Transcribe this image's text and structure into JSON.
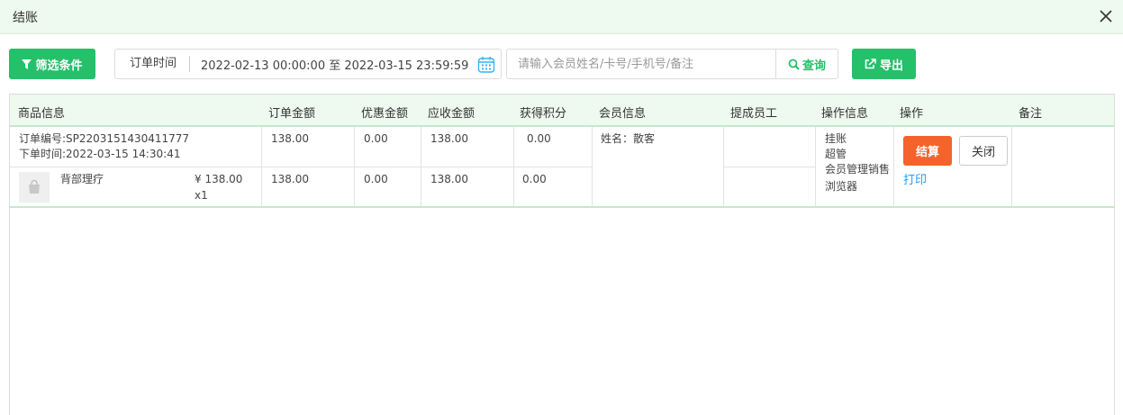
{
  "window": {
    "title": "结账"
  },
  "toolbar": {
    "filter_label": "筛选条件",
    "date_label": "订单时间",
    "date_range": "2022-02-13 00:00:00 至 2022-03-15 23:59:59",
    "search_placeholder": "请输入会员姓名/卡号/手机号/备注",
    "query_label": "查询",
    "export_label": "导出"
  },
  "table": {
    "headers": [
      "商品信息",
      "订单金额",
      "优惠金额",
      "应收金额",
      "获得积分",
      "会员信息",
      "提成员工",
      "操作信息",
      "操作",
      "备注"
    ],
    "order": {
      "order_no": "订单编号:SP2203151430411777",
      "order_time": "下单时间:2022-03-15 14:30:41",
      "amount": "138.00",
      "discount": "0.00",
      "receivable": "138.00",
      "points": "0.00",
      "member": "姓名：散客",
      "ops": [
        "挂账",
        "超管",
        "会员管理销售",
        "浏览器"
      ],
      "settle_label": "结算",
      "close_label": "关闭",
      "print_label": "打印"
    },
    "item": {
      "name": "背部理疗",
      "price": "¥ 138.00",
      "qty": "x1",
      "amount": "138.00",
      "discount": "0.00",
      "receivable": "138.00",
      "points": "0.00"
    }
  }
}
